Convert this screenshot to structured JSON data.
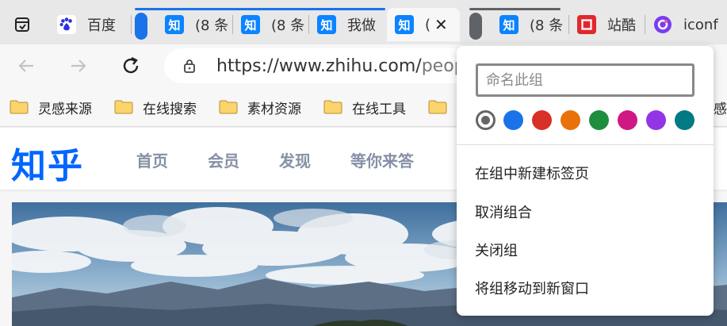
{
  "tabs": [
    {
      "title": "百度",
      "favicon": "baidu-paw-icon",
      "color": "#ffffff"
    },
    {
      "title": "(8 条",
      "favicon": "zhihu-icon",
      "color": "#0a84ff"
    },
    {
      "title": "(8 条",
      "favicon": "zhihu-icon",
      "color": "#0a84ff"
    },
    {
      "title": "我做",
      "favicon": "zhihu-icon",
      "color": "#0a84ff"
    },
    {
      "title": "(",
      "favicon": "zhihu-icon",
      "color": "#0a84ff"
    },
    {
      "title": "(8 条",
      "favicon": "zhihu-icon",
      "color": "#0a84ff"
    },
    {
      "title": "站酷",
      "favicon": "zcool-icon",
      "color": "#e0282d"
    },
    {
      "title": "iconf",
      "favicon": "iconfont-icon",
      "color": "#7a3df0"
    }
  ],
  "favicon_glyph": "知",
  "active_close": "✕",
  "address": {
    "domain": "https://www.zhihu.com/",
    "path": "peop"
  },
  "bookmarks": [
    "灵感来源",
    "在线搜索",
    "素材资源",
    "在线工具"
  ],
  "bookmark_overflow": "感",
  "site": {
    "logo": "知乎",
    "nav": [
      "首页",
      "会员",
      "发现",
      "等你来答"
    ]
  },
  "group_menu": {
    "placeholder": "命名此组",
    "colors": [
      "#666666",
      "#1a73e8",
      "#d93025",
      "#e8710a",
      "#1e8e3e",
      "#d01884",
      "#9334e6",
      "#007b83"
    ],
    "items": [
      "在组中新建标签页",
      "取消组合",
      "关闭组",
      "将组移动到新窗口"
    ]
  }
}
